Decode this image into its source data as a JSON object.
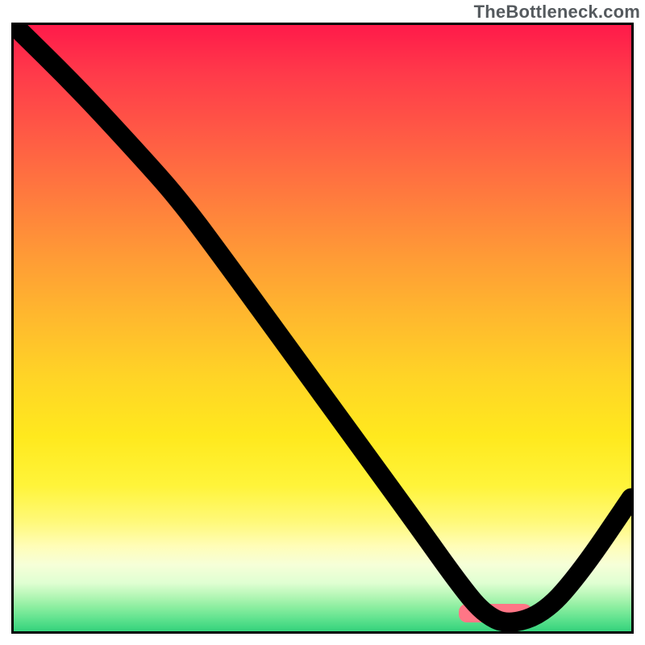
{
  "watermark": "TheBottleneck.com",
  "colors": {
    "frame_border": "#000000",
    "curve_stroke": "#000000",
    "marker_fill": "#ff7686",
    "gradient_stops": [
      "#ff1a4a",
      "#ff3a4a",
      "#ff5a45",
      "#ff7a3e",
      "#ff9a36",
      "#ffb82e",
      "#ffd426",
      "#ffe91e",
      "#fff43a",
      "#fff97a",
      "#fffdb8",
      "#f6ffd8",
      "#e0ffd2",
      "#b8f7b8",
      "#8ceea0",
      "#5ee28e",
      "#34d37c"
    ]
  },
  "chart_data": {
    "type": "line",
    "title": "",
    "xlabel": "",
    "ylabel": "",
    "xlim": [
      0,
      100
    ],
    "ylim": [
      0,
      100
    ],
    "note": "Axes have no visible tick labels; x/y are normalized 0–100 across the plot area. Lower y = lower on screen (green = good / low bottleneck).",
    "series": [
      {
        "name": "curve",
        "x": [
          0,
          10,
          20,
          27,
          35,
          45,
          55,
          65,
          72,
          76,
          80,
          86,
          92,
          100
        ],
        "y": [
          100,
          90,
          79,
          71,
          60,
          46,
          32,
          18,
          8,
          3,
          1,
          3,
          10,
          22
        ]
      }
    ],
    "marker": {
      "name": "optimal-band",
      "x_center": 78,
      "y_center": 3,
      "width": 12,
      "height": 3
    }
  }
}
